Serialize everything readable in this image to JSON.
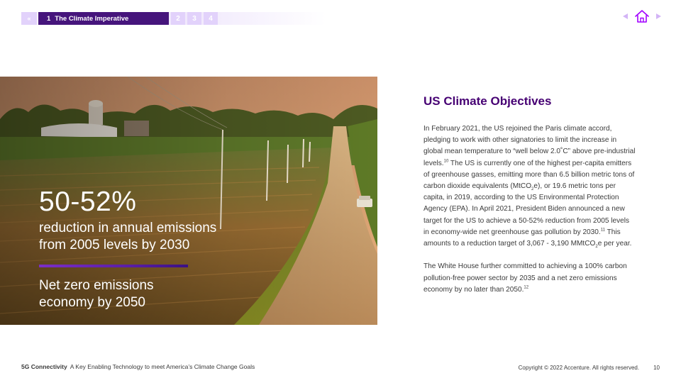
{
  "nav": {
    "prev_glyph": "«",
    "active_number": "1",
    "active_label": "The Climate Imperative",
    "sections": [
      "2",
      "3",
      "4"
    ]
  },
  "top_right": {
    "prev_icon": "triangle-left-icon",
    "home_icon": "home-icon",
    "next_icon": "triangle-right-icon"
  },
  "hero": {
    "stat_value": "50-52%",
    "stat_line1": "reduction in annual emissions",
    "stat_line2": "from 2005 levels by 2030",
    "goal_line1": "Net zero emissions",
    "goal_line2": "economy by 2050"
  },
  "content": {
    "heading": "US Climate Objectives",
    "p1_a": "In February 2021, the US rejoined the Paris climate accord, pledging to work with other signatories to limit the increase in global mean temperature to “well below 2.0˚C” above pre-industrial levels.",
    "p1_ref1": "10",
    "p1_b": " The US is currently one of the highest per-capita emitters of greenhouse gasses, emitting more than 6.5 billion metric tons of carbon dioxide equivalents (MtCO",
    "p1_sub1": "2",
    "p1_c": "e), or 19.6 metric tons per capita, in 2019, according to the US Environmental Protection Agency (EPA). In April 2021, President Biden announced a new target for the US to achieve a 50-52% reduction from 2005 levels in economy-wide net greenhouse gas pollution by 2030.",
    "p1_ref2": "11",
    "p1_d": " This amounts to a reduction target of 3,067 - 3,190 MMtCO",
    "p1_sub2": "2",
    "p1_e": "e per year.",
    "p2_a": "The White House further committed to achieving a 100% carbon pollution-free power sector by 2035 and a net zero emissions economy by no later than 2050.",
    "p2_ref": "12"
  },
  "footer": {
    "brand": "5G Connectivity",
    "title": "A Key Enabling Technology to meet America’s Climate Change Goals",
    "copyright": "Copyright © 2022 Accenture. All rights reserved.",
    "page_number": "10"
  },
  "colors": {
    "accent_purple": "#460073",
    "nav_active": "#46157c",
    "nav_inactive": "#e2d2fb",
    "icon_purple": "#a100ff"
  }
}
